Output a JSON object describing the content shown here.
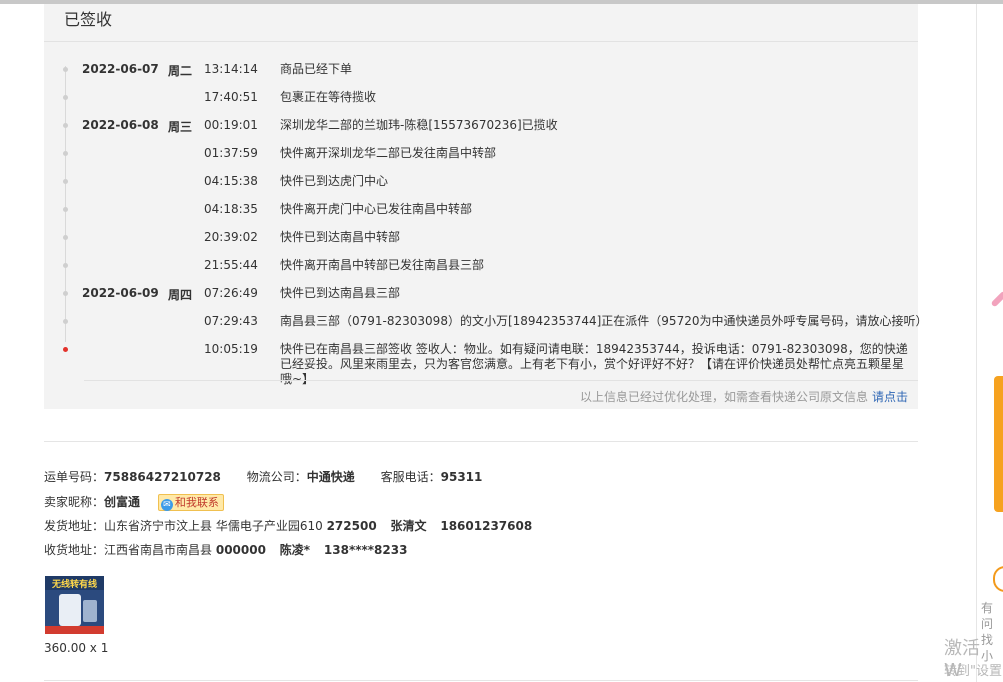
{
  "panel": {
    "title": "已签收",
    "note": "以上信息已经过优化处理，如需查看快递公司原文信息",
    "note_link": "请点击"
  },
  "timeline": [
    {
      "date": "2022-06-07",
      "weekday": "周二",
      "time": "13:14:14",
      "desc": "商品已经下单"
    },
    {
      "date": "",
      "weekday": "",
      "time": "17:40:51",
      "desc": "包裹正在等待揽收"
    },
    {
      "date": "2022-06-08",
      "weekday": "周三",
      "time": "00:19:01",
      "desc": "深圳龙华二部的兰珈玮-陈稳[15573670236]已揽收"
    },
    {
      "date": "",
      "weekday": "",
      "time": "01:37:59",
      "desc": "快件离开深圳龙华二部已发往南昌中转部"
    },
    {
      "date": "",
      "weekday": "",
      "time": "04:15:38",
      "desc": "快件已到达虎门中心"
    },
    {
      "date": "",
      "weekday": "",
      "time": "04:18:35",
      "desc": "快件离开虎门中心已发往南昌中转部"
    },
    {
      "date": "",
      "weekday": "",
      "time": "20:39:02",
      "desc": "快件已到达南昌中转部"
    },
    {
      "date": "",
      "weekday": "",
      "time": "21:55:44",
      "desc": "快件离开南昌中转部已发往南昌县三部"
    },
    {
      "date": "2022-06-09",
      "weekday": "周四",
      "time": "07:26:49",
      "desc": "快件已到达南昌县三部"
    },
    {
      "date": "",
      "weekday": "",
      "time": "07:29:43",
      "desc": "南昌县三部（0791-82303098）的文小万[18942353744]正在派件（95720为中通快递员外呼专属号码，请放心接听）"
    },
    {
      "date": "",
      "weekday": "",
      "time": "10:05:19",
      "desc": "快件已在南昌县三部签收 签收人：物业。如有疑问请电联：18942353744，投诉电话：0791-82303098，您的快递已经妥投。风里来雨里去，只为客官您满意。上有老下有小，赏个好评好不好？【请在评价快递员处帮忙点亮五颗星星哦~】"
    }
  ],
  "shipping": {
    "waybill_label": "运单号码：",
    "waybill": "75886427210728",
    "carrier_label": "物流公司：",
    "carrier": "中通快递",
    "service_label": "客服电话：",
    "service_phone": "95311",
    "seller_label": "卖家昵称：",
    "seller": "创富通",
    "chat_label": "和我联系",
    "from_label": "发货地址：",
    "from_address": "山东省济宁市汶上县 华儒电子产业园610",
    "from_zip": "272500",
    "from_name": "张清文",
    "from_phone": "18601237608",
    "to_label": "收货地址：",
    "to_address": "江西省南昌市南昌县",
    "to_zip": "000000",
    "to_name": "陈凌*",
    "to_phone": "138****8233"
  },
  "product": {
    "image_text": "无线转有线",
    "price": "360.00 x 1"
  },
  "sidebar": {
    "help_text_1": "有问",
    "help_text_2": "找小"
  },
  "watermark": {
    "line1": "激活 W",
    "line2": "转到\"设置"
  }
}
